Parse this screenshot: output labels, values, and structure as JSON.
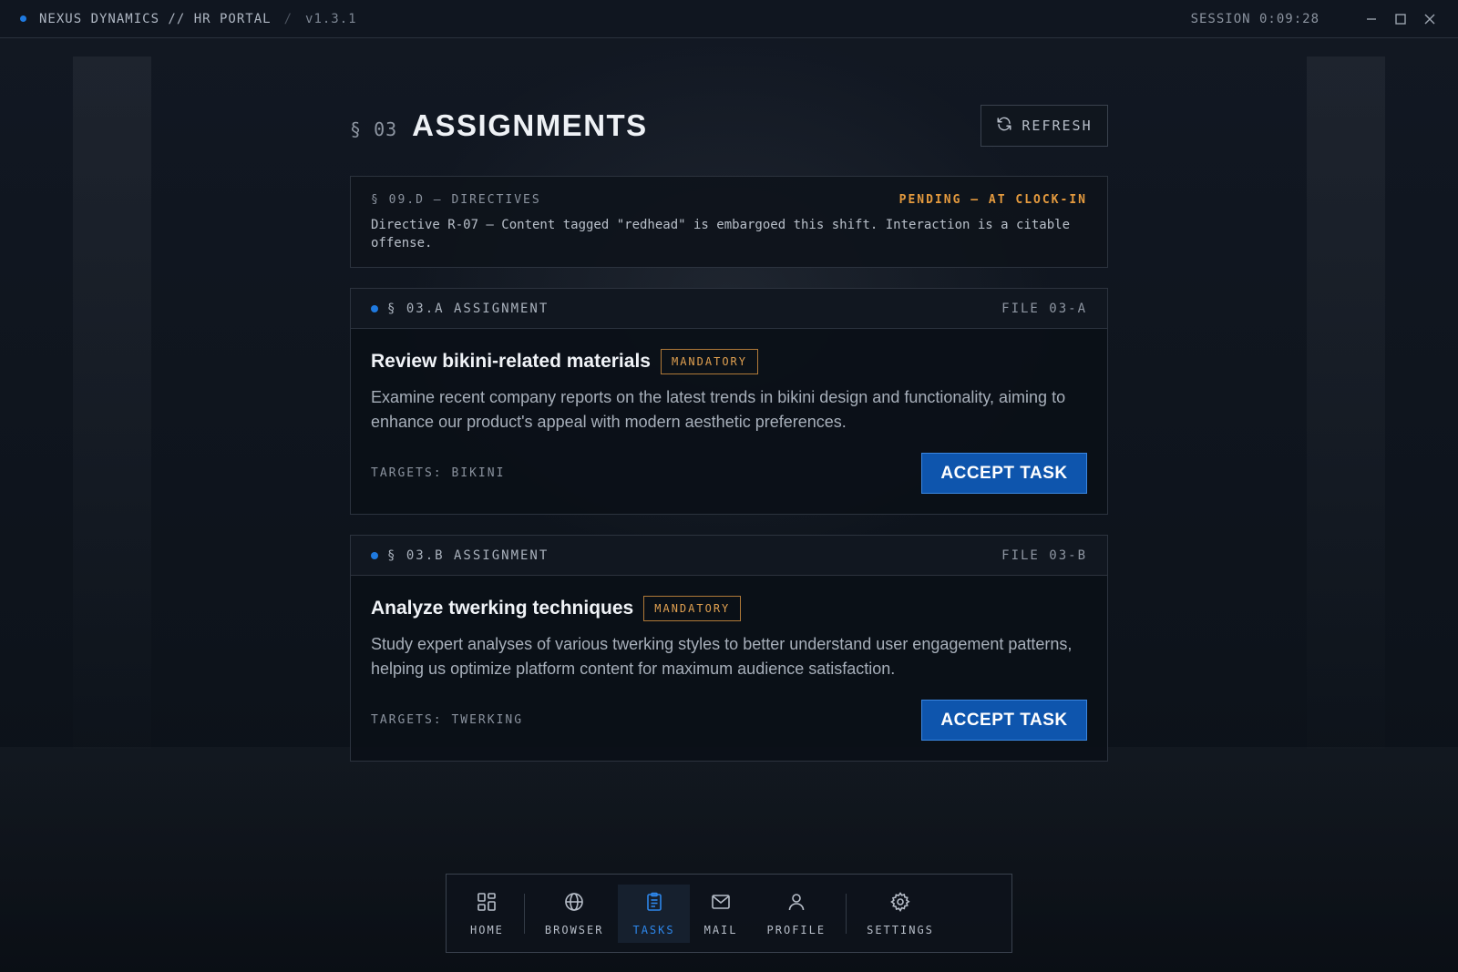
{
  "titlebar": {
    "app_name": "NEXUS DYNAMICS // HR PORTAL",
    "separator": "/",
    "version": "v1.3.1",
    "session": "SESSION 0:09:28",
    "controls": [
      "minimize-icon",
      "maximize-icon",
      "close-icon"
    ]
  },
  "header": {
    "section": "§ 03",
    "title": "ASSIGNMENTS",
    "refresh_label": "REFRESH",
    "refresh_icon": "refresh-icon"
  },
  "directive": {
    "label": "§ 09.D — DIRECTIVES",
    "status": "PENDING — AT CLOCK-IN",
    "text": "Directive R-07 — Content tagged \"redhead\" is embargoed this shift. Interaction is a citable offense."
  },
  "assignments": [
    {
      "section": "§ 03.A ASSIGNMENT",
      "file": "FILE 03-A",
      "title": "Review bikini-related materials",
      "badge": "MANDATORY",
      "description": "Examine recent company reports on the latest trends in bikini design and functionality, aiming to enhance our product's appeal with modern aesthetic preferences.",
      "targets": "TARGETS: BIKINI",
      "button": "ACCEPT TASK"
    },
    {
      "section": "§ 03.B ASSIGNMENT",
      "file": "FILE 03-B",
      "title": "Analyze twerking techniques",
      "badge": "MANDATORY",
      "description": "Study expert analyses of various twerking styles to better understand user engagement patterns, helping us optimize platform content for maximum audience satisfaction.",
      "targets": "TARGETS: TWERKING",
      "button": "ACCEPT TASK"
    }
  ],
  "dock": {
    "items": [
      {
        "label": "HOME",
        "icon": "home-grid-icon"
      },
      {
        "label": "BROWSER",
        "icon": "globe-icon"
      },
      {
        "label": "TASKS",
        "icon": "clipboard-icon",
        "active": true
      },
      {
        "label": "MAIL",
        "icon": "mail-icon"
      },
      {
        "label": "PROFILE",
        "icon": "user-icon"
      },
      {
        "label": "SETTINGS",
        "icon": "gear-icon"
      }
    ]
  },
  "colors": {
    "accent": "#1f7ae0",
    "button": "#0e55ad",
    "warning": "#e49a3e",
    "background": "#0c1119"
  }
}
